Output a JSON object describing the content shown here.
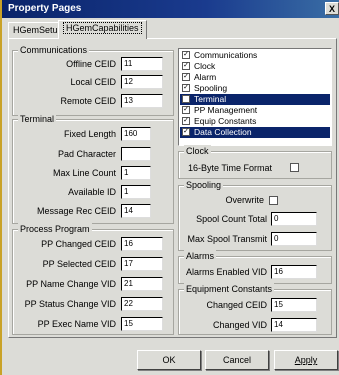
{
  "window": {
    "title": "Property Pages",
    "close_glyph": "X"
  },
  "tabs": [
    {
      "label": "HGemSetup"
    },
    {
      "label": "HGemCapabilities"
    }
  ],
  "communications": {
    "legend": "Communications",
    "fields": [
      {
        "label": "Offline CEID",
        "value": "11"
      },
      {
        "label": "Local CEID",
        "value": "12"
      },
      {
        "label": "Remote CEID",
        "value": "13"
      }
    ]
  },
  "terminal": {
    "legend": "Terminal",
    "fields": [
      {
        "label": "Fixed Length",
        "value": "160"
      },
      {
        "label": "Pad Character",
        "value": ""
      },
      {
        "label": "Max Line Count",
        "value": "1"
      },
      {
        "label": "Available ID",
        "value": "1"
      },
      {
        "label": "Message Rec CEID",
        "value": "14"
      }
    ]
  },
  "process_program": {
    "legend": "Process Program",
    "fields": [
      {
        "label": "PP Changed CEID",
        "value": "16"
      },
      {
        "label": "PP Selected CEID",
        "value": "17"
      },
      {
        "label": "PP Name Change VID",
        "value": "21"
      },
      {
        "label": "PP Status Change VID",
        "value": "22"
      },
      {
        "label": "PP Exec Name VID",
        "value": "15"
      }
    ]
  },
  "capabilities": {
    "items": [
      {
        "label": "Communications",
        "checked": true,
        "selected": false
      },
      {
        "label": "Clock",
        "checked": true,
        "selected": false
      },
      {
        "label": "Alarm",
        "checked": true,
        "selected": false
      },
      {
        "label": "Spooling",
        "checked": true,
        "selected": false
      },
      {
        "label": "Terminal",
        "checked": false,
        "selected": true
      },
      {
        "label": "PP Management",
        "checked": true,
        "selected": false
      },
      {
        "label": "Equip Constants",
        "checked": true,
        "selected": false
      },
      {
        "label": "Data Collection",
        "checked": true,
        "selected": true
      }
    ]
  },
  "clock": {
    "legend": "Clock",
    "label": "16-Byte Time Format",
    "checked": false
  },
  "spooling": {
    "legend": "Spooling",
    "overwrite_label": "Overwrite",
    "overwrite_checked": false,
    "fields": [
      {
        "label": "Spool Count Total",
        "value": "0"
      },
      {
        "label": "Max Spool Transmit",
        "value": "0"
      }
    ]
  },
  "alarms": {
    "legend": "Alarms",
    "fields": [
      {
        "label": "Alarms Enabled VID",
        "value": "16"
      }
    ]
  },
  "equipment_constants": {
    "legend": "Equipment Constants",
    "fields": [
      {
        "label": "Changed CEID",
        "value": "15"
      },
      {
        "label": "Changed VID",
        "value": "14"
      }
    ]
  },
  "buttons": {
    "ok": "OK",
    "cancel": "Cancel",
    "apply": "Apply"
  }
}
